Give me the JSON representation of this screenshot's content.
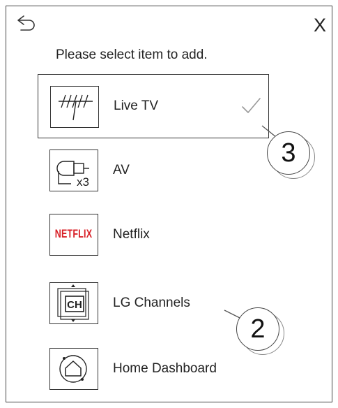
{
  "header": {
    "back_icon": "back-arrow-icon",
    "close_label": "X"
  },
  "prompt": "Please select item to add.",
  "items": [
    {
      "label": "Live TV",
      "icon": "antenna-icon",
      "selected": true
    },
    {
      "label": "AV",
      "icon": "av-cable-icon",
      "icon_text": "x3",
      "selected": false
    },
    {
      "label": "Netflix",
      "icon": "netflix-logo-icon",
      "icon_text": "NETFLIX",
      "selected": false
    },
    {
      "label": "LG Channels",
      "icon": "lg-channels-icon",
      "icon_text": "CH",
      "selected": false
    },
    {
      "label": "Home Dashboard",
      "icon": "home-dashboard-icon",
      "selected": false
    }
  ],
  "callouts": [
    "3",
    "2"
  ],
  "colors": {
    "netflix_red": "#d81f26",
    "border": "#333333"
  }
}
